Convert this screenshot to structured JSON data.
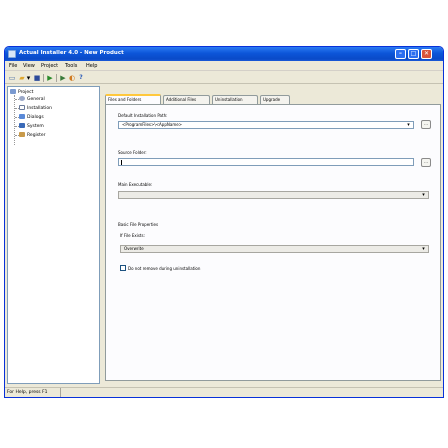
{
  "window": {
    "title": "Actual Installer 4.0 - New Product"
  },
  "window_buttons": {
    "minimize": "–",
    "maximize": "□",
    "close": "✕"
  },
  "menu": [
    "File",
    "View",
    "Project",
    "Tools",
    "Help"
  ],
  "toolbar": {
    "icons": [
      "new-document-icon",
      "open-folder-icon",
      "dropdown-arrow-icon",
      "save-icon",
      "build-icon",
      "run-icon",
      "test-icon",
      "help-icon"
    ],
    "glyphs": {
      "new": "▭",
      "open": "▰",
      "dropdown": "▾",
      "save": "■",
      "build": "▶",
      "run": "▶",
      "test": "◐",
      "help": "?"
    }
  },
  "tree": {
    "root": "Project",
    "items": [
      "General",
      "Installation",
      "Dialogs",
      "System",
      "Register"
    ],
    "selected": "Installation"
  },
  "tabs": [
    "Files and Folders",
    "Additional Files",
    "Uninstallation",
    "Upgrade"
  ],
  "active_tab": "Files and Folders",
  "form": {
    "default_path_label": "Default Installation Path:",
    "default_path_value": "<ProgramFiles>\\<AppName>",
    "source_folder_label": "Source Folder:",
    "source_folder_value": "",
    "main_exe_label": "Main Executable:",
    "main_exe_value": "",
    "basic_props_label": "Basic File Properties",
    "if_exists_label": "If File Exists:",
    "if_exists_value": "Overwrite",
    "checkbox_label": "Do not remove during uninstallation",
    "checkbox_checked": false,
    "browse_label": "..."
  },
  "status": {
    "text": "For Help, press F1"
  }
}
